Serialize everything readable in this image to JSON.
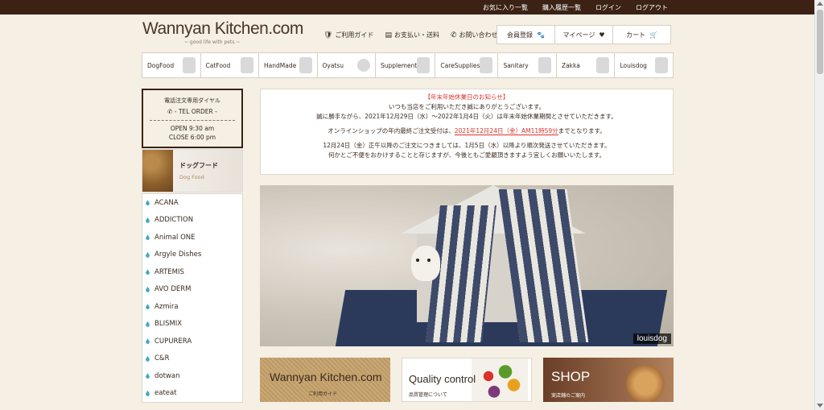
{
  "topbar": {
    "links": [
      "お気に入り一覧",
      "購入履歴一覧",
      "ログイン",
      "ログアウト"
    ]
  },
  "logo": {
    "name": "Wannyan Kitchen.com",
    "tagline": "~ good life with pets ~"
  },
  "header_nav": [
    {
      "icon": "shield-icon",
      "glyph": "🛡",
      "label": "ご利用ガイド"
    },
    {
      "icon": "document-icon",
      "glyph": "▤",
      "label": "お支払い・送料"
    },
    {
      "icon": "phone-icon",
      "glyph": "✆",
      "label": "お問い合わせ"
    }
  ],
  "account_buttons": [
    {
      "label": "会員登録",
      "icon": "paw-icon",
      "glyph": "🐾"
    },
    {
      "label": "マイページ",
      "icon": "heart-icon",
      "glyph": "♥"
    },
    {
      "label": "カート",
      "icon": "cart-icon",
      "glyph": "🛒"
    }
  ],
  "categories": [
    "DogFood",
    "CatFood",
    "HandMade",
    "Oyatsu",
    "Supplement",
    "CareSupplies",
    "Sanitary",
    "Zakka",
    "Louisdog"
  ],
  "tel_box": {
    "title": "電話注文専用ダイヤル",
    "order": "- TEL ORDER -",
    "open": "OPEN 9:30 am",
    "close": "CLOSE 6:00 pm"
  },
  "dogfood_banner": {
    "title_jp": "ドッグフード",
    "title_en": "Dog Food"
  },
  "brands": [
    "ACANA",
    "ADDICTION",
    "Animal ONE",
    "Argyle Dishes",
    "ARTEMIS",
    "AVO DERM",
    "Azmira",
    "BLISMIX",
    "CUPURERA",
    "C&R",
    "dotwan",
    "eateat"
  ],
  "notice": {
    "title": "【年末年始休業日のお知らせ】",
    "line1": "いつも当店をご利用いただき誠にありがとうございます。",
    "line2": "誠に勝手ながら、2021年12月29日（水）～2022年1月4日（火）は年末年始休業期間とさせていただきます。",
    "line3_pre": "オンラインショップの年内最終ご注文受付は、",
    "line3_red": "2021年12月24日（金）AM11時59分",
    "line3_post": "までとなります。",
    "line4": "12月24日（金）正午以降のご注文につきましては、1月5日（水）以降より順次発送させていただきます。",
    "line5": "何かとご不便をおかけすることと存じますが、今後ともご愛顧頂きますよう宜しくお願いいたします。"
  },
  "hero": {
    "caption": "louisdog"
  },
  "banners": [
    {
      "title": "Wannyan Kitchen.com",
      "subtitle": "ご利用ガイド"
    },
    {
      "title": "Quality control",
      "subtitle": "品質管理について"
    },
    {
      "title": "SHOP",
      "subtitle": "実店舗のご案内"
    }
  ],
  "colors": {
    "topbar": "#3b2214",
    "background": "#f5efe4",
    "accent_red": "#d9332a",
    "brand_bullet": "#45a6c7"
  }
}
